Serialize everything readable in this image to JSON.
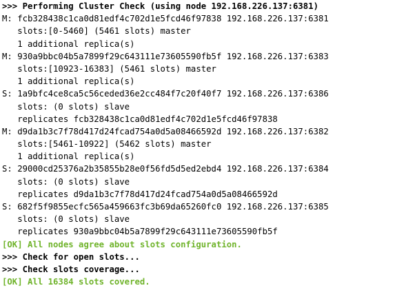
{
  "terminal": {
    "colors": {
      "background": "#ffffff",
      "text": "#000000",
      "ok_green": "#6fb32a"
    },
    "header": ">>> Performing Cluster Check (using node 192.168.226.137:6381)",
    "nodes": [
      {
        "line": "M: fcb328438c1ca0d81edf4c702d1e5fcd46f97838 192.168.226.137:6381",
        "slots": "   slots:[0-5460] (5461 slots) master",
        "extra": "   1 additional replica(s)"
      },
      {
        "line": "M: 930a9bbc04b5a7899f29c643111e73605590fb5f 192.168.226.137:6383",
        "slots": "   slots:[10923-16383] (5461 slots) master",
        "extra": "   1 additional replica(s)"
      },
      {
        "line": "S: 1a9bfc4ce8ca5c56ceded36e2cc484f7c20f40f7 192.168.226.137:6386",
        "slots": "   slots: (0 slots) slave",
        "extra": "   replicates fcb328438c1ca0d81edf4c702d1e5fcd46f97838"
      },
      {
        "line": "M: d9da1b3c7f78d417d24fcad754a0d5a08466592d 192.168.226.137:6382",
        "slots": "   slots:[5461-10922] (5462 slots) master",
        "extra": "   1 additional replica(s)"
      },
      {
        "line": "S: 29000cd25376a2b35855b28e0f56fd5d5ed2ebd4 192.168.226.137:6384",
        "slots": "   slots: (0 slots) slave",
        "extra": "   replicates d9da1b3c7f78d417d24fcad754a0d5a08466592d"
      },
      {
        "line": "S: 682f5f9855ecfc565a459663fc3b69da65260fc0 192.168.226.137:6385",
        "slots": "   slots: (0 slots) slave",
        "extra": "   replicates 930a9bbc04b5a7899f29c643111e73605590fb5f"
      }
    ],
    "ok_agree": "[OK] All nodes agree about slots configuration.",
    "check_open": ">>> Check for open slots...",
    "check_coverage": ">>> Check slots coverage...",
    "ok_covered": "[OK] All 16384 slots covered."
  }
}
